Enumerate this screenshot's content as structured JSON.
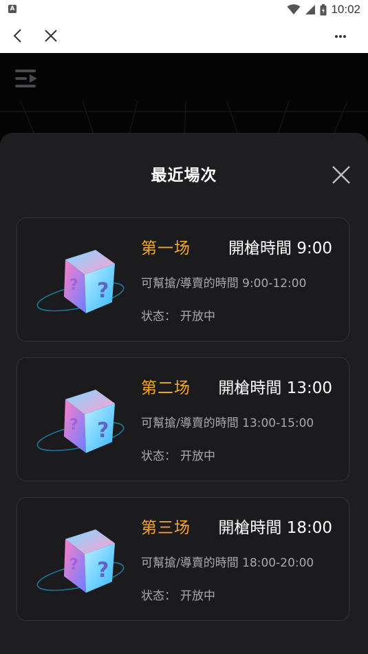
{
  "status_bar": {
    "app_badge": "A",
    "time": "10:02"
  },
  "nav": {
    "back_icon": "chevron-left-icon",
    "close_icon": "close-icon",
    "more_icon": "more-horizontal-icon"
  },
  "page": {
    "menu_icon": "menu-play-icon"
  },
  "sheet": {
    "title": "最近場次",
    "close_icon": "close-icon",
    "sessions": [
      {
        "name": "第一场",
        "open_time": "開槍時間 9:00",
        "window": "可幫搶/導賣的時間 9:00-12:00",
        "status_label": "状态：",
        "status_value": "开放中"
      },
      {
        "name": "第二场",
        "open_time": "開槍時間 13:00",
        "window": "可幫搶/導賣的時間 13:00-15:00",
        "status_label": "状态：",
        "status_value": "开放中"
      },
      {
        "name": "第三场",
        "open_time": "開槍時間 18:00",
        "window": "可幫搶/導賣的時間 18:00-20:00",
        "status_label": "状态：",
        "status_value": "开放中"
      }
    ]
  },
  "colors": {
    "accent": "#f5a623",
    "sheet_bg": "#1e1e21",
    "card_border": "#333338",
    "secondary_text": "#a8a8ad"
  }
}
